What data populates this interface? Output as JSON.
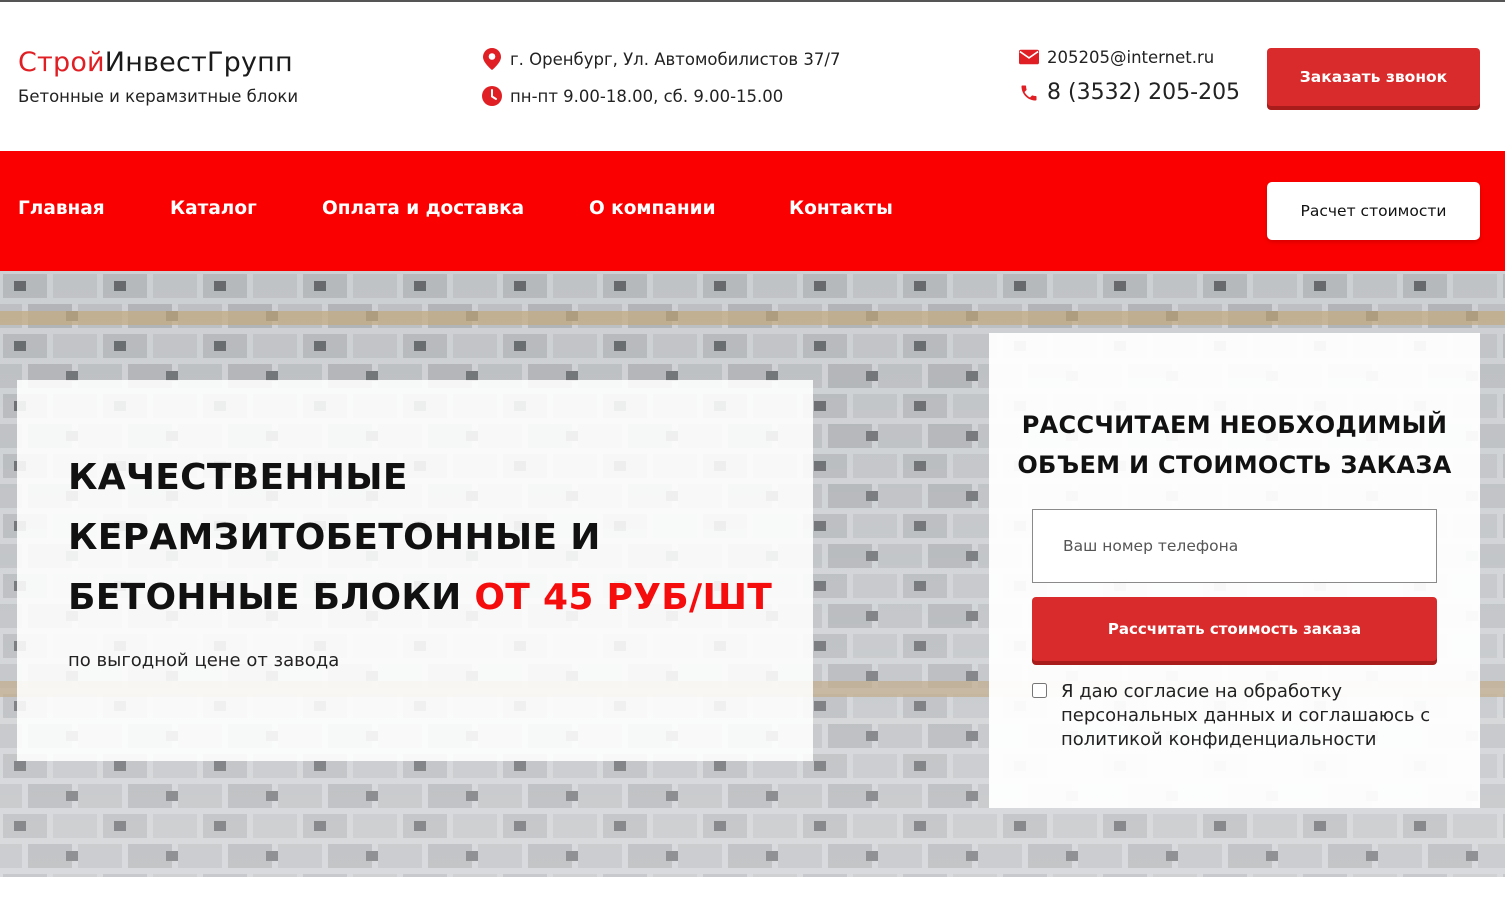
{
  "header": {
    "logo_part1": "Строй",
    "logo_part2": "ИнвестГрупп",
    "tagline": "Бетонные и керамзитные блоки",
    "address": "г. Оренбург, Ул. Автомобилистов 37/7",
    "hours": "пн-пт 9.00-18.00, сб. 9.00-15.00",
    "email": "205205@internet.ru",
    "phone": "8 (3532) 205-205",
    "callback_button": "Заказать звонок",
    "icons": {
      "address": "map-pin-icon",
      "hours": "clock-icon",
      "email": "envelope-icon",
      "phone": "phone-icon"
    }
  },
  "nav": {
    "items": [
      {
        "label": "Главная"
      },
      {
        "label": "Каталог"
      },
      {
        "label": "Оплата и доставка"
      },
      {
        "label": "О компании"
      },
      {
        "label": "Контакты"
      }
    ],
    "calc_button": "Расчет стоимости"
  },
  "hero": {
    "title_main": "Качественные керамзитобетонные и бетонные блоки ",
    "title_price": "от 45 руб/шт",
    "subtitle": "по выгодной цене от завода"
  },
  "form": {
    "title": "Рассчитаем необходимый объем и стоимость заказа",
    "phone_placeholder": "Ваш номер телефона",
    "submit_button": "Рассчитать стоимость заказа",
    "consent_text": "Я даю согласие на обработку персональных данных и соглашаюсь с политикой конфиденциальности"
  },
  "colors": {
    "brand_red": "#e01f24",
    "nav_red": "#fa0000",
    "button_red": "#d92b2b"
  }
}
